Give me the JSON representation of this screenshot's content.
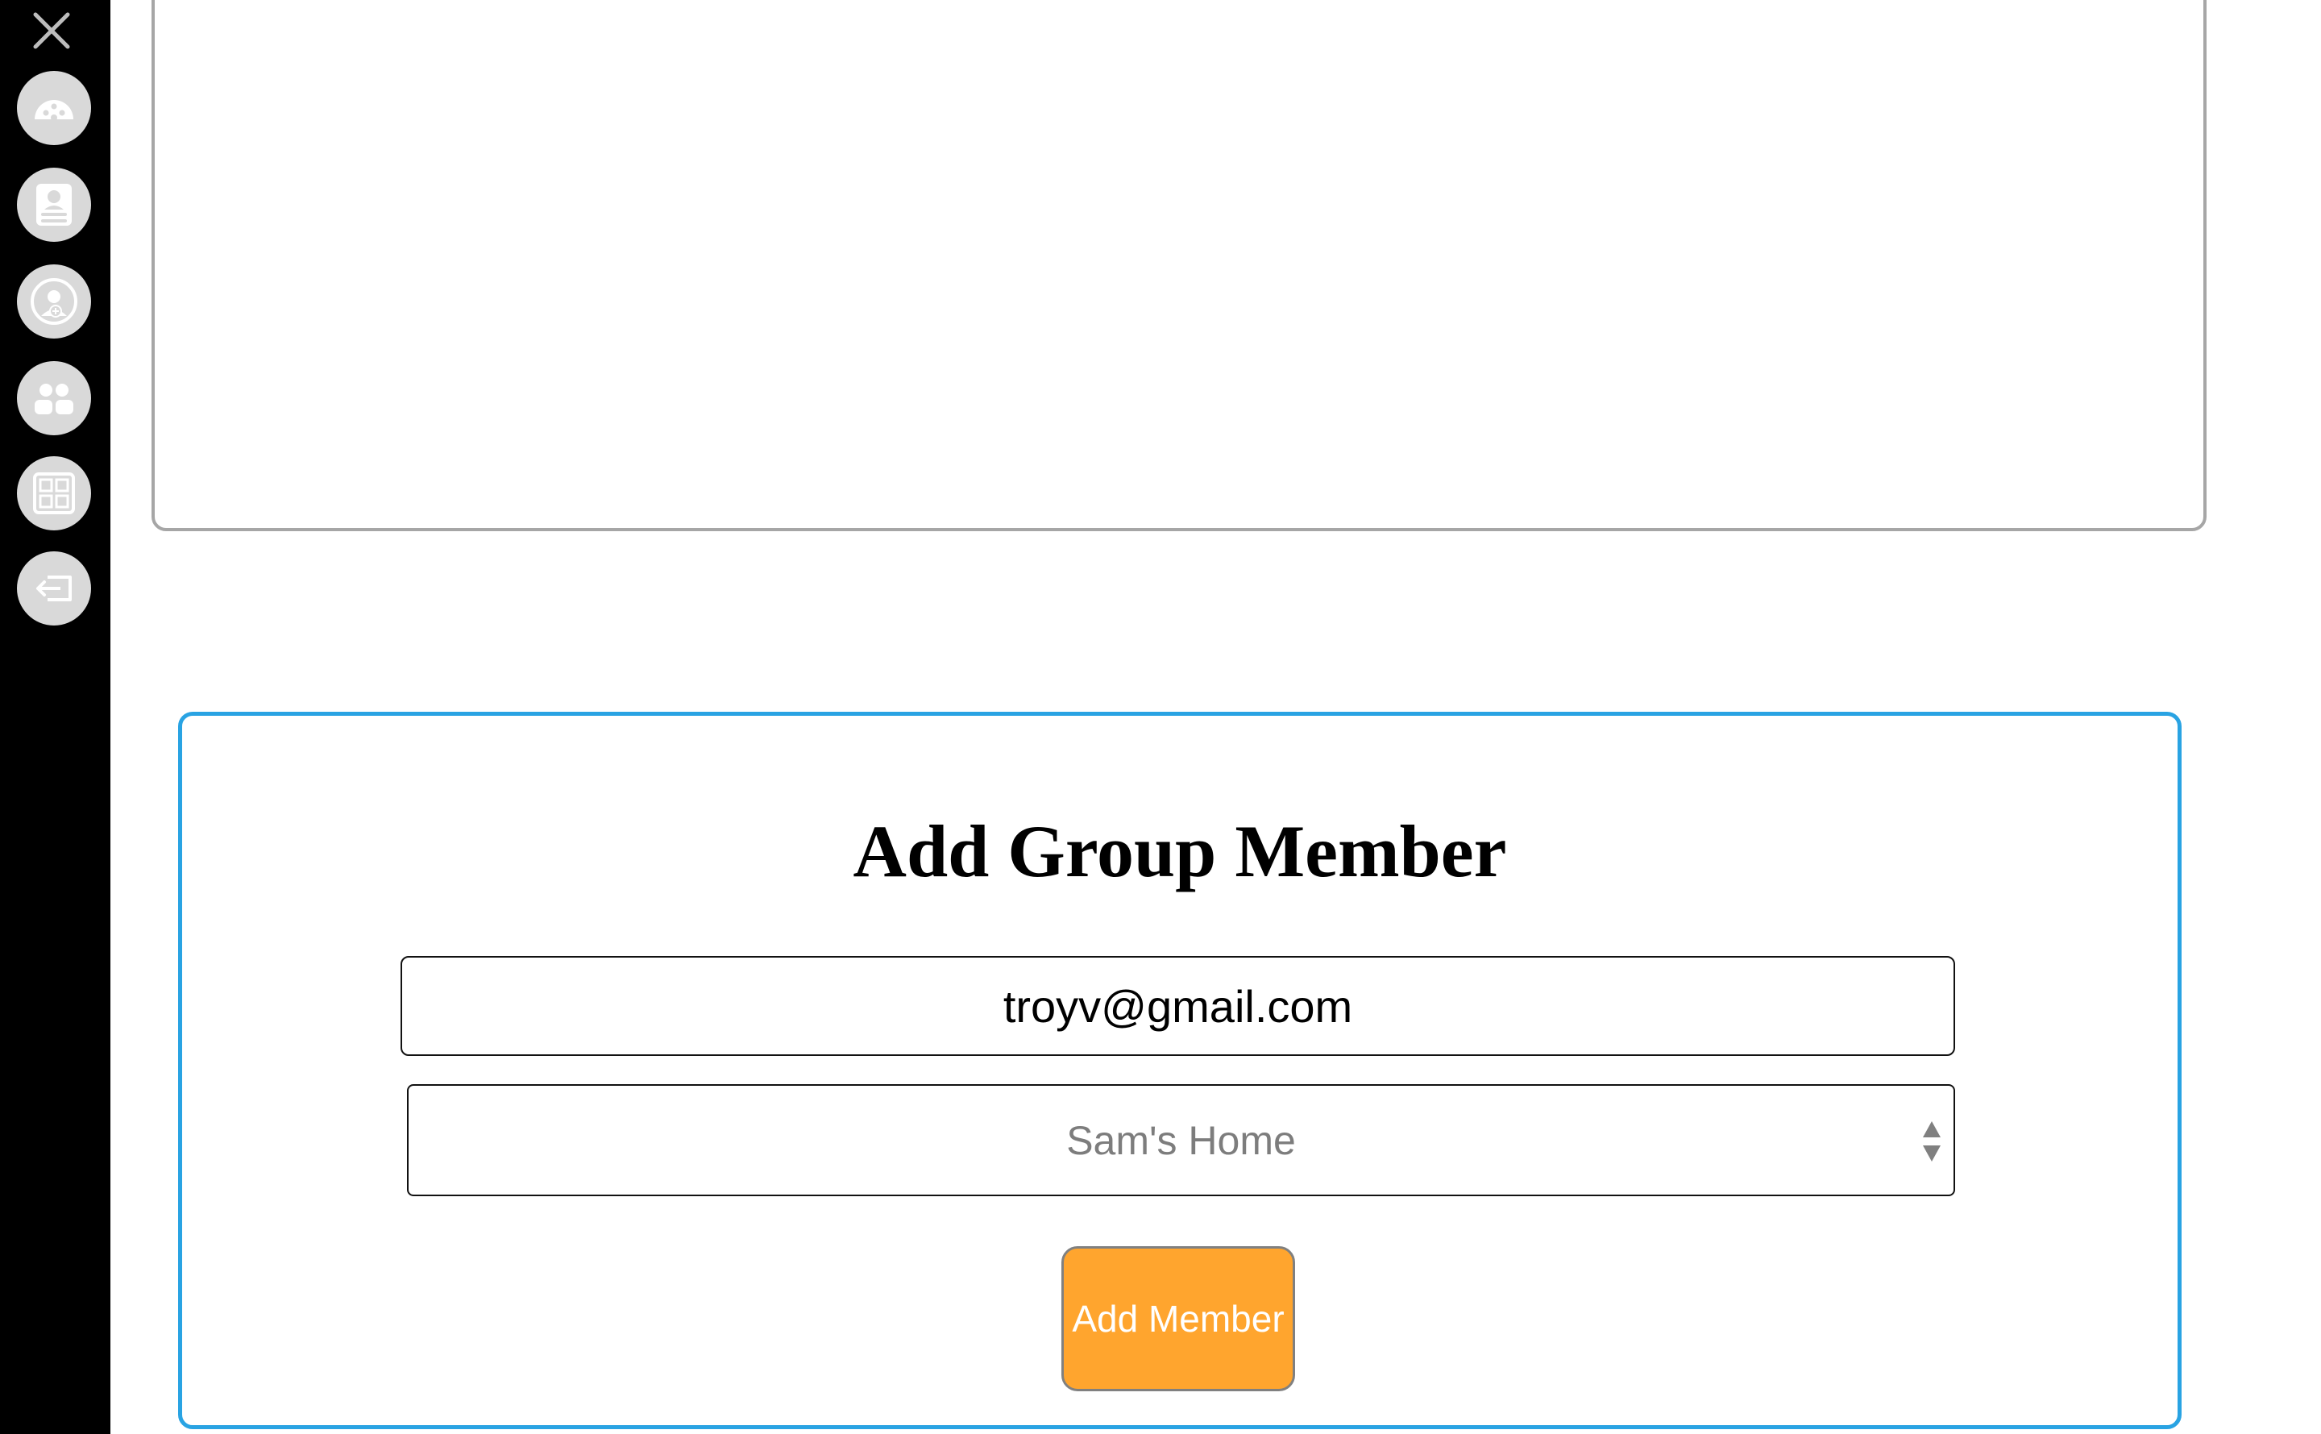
{
  "sidebar": {
    "close_icon": "close-icon",
    "items": [
      {
        "name": "dashboard",
        "icon": "gauge-icon"
      },
      {
        "name": "profile",
        "icon": "id-card-icon"
      },
      {
        "name": "add-user",
        "icon": "user-plus-icon"
      },
      {
        "name": "group",
        "icon": "users-icon"
      },
      {
        "name": "calculator",
        "icon": "calculator-icon"
      },
      {
        "name": "logout",
        "icon": "logout-icon"
      }
    ]
  },
  "form": {
    "title": "Add Group Member",
    "email_value": "troyv@gmail.com",
    "home_selected": "Sam's Home",
    "submit_label": "Add Member"
  },
  "colors": {
    "sidebar_bg": "#000000",
    "icon_bg": "#d9d9d9",
    "card_border": "#29a3e3",
    "button_bg": "#ffa52e",
    "panel_border": "#a6a6a6"
  }
}
